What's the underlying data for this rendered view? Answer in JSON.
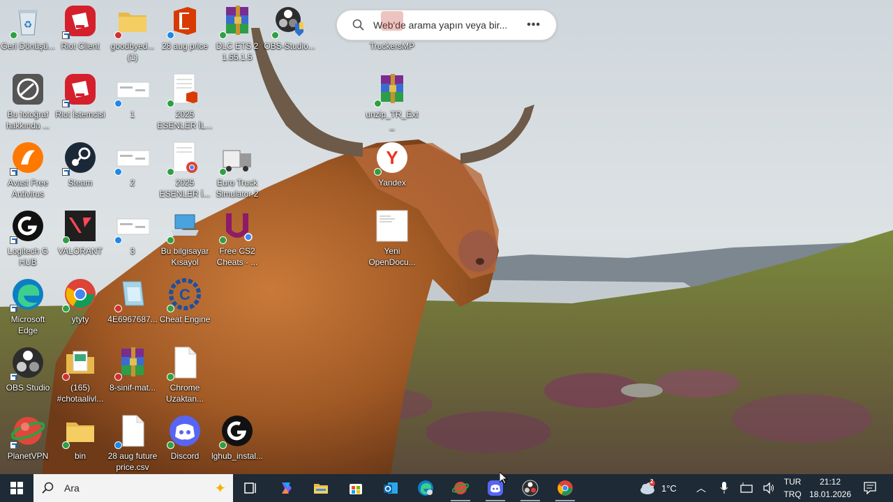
{
  "search_widget": {
    "placeholder": "Web'de arama yapın veya bir...",
    "more_icon": "ellipsis-icon"
  },
  "desktop_icons": [
    {
      "label": "Geri Dönüşü...",
      "icon": "recycle-bin-icon"
    },
    {
      "label": "Riot Client",
      "icon": "riot-icon"
    },
    {
      "label": "goodbyed... (1)",
      "icon": "folder-icon"
    },
    {
      "label": "28 aug price",
      "icon": "office-icon"
    },
    {
      "label": "DLC ETS 2 1.55.1.5",
      "icon": "winrar-icon"
    },
    {
      "label": "OBS-Studio...",
      "icon": "obs-installer-icon"
    },
    {
      "label": "TruckersMP",
      "icon": "truckersmp-icon"
    },
    {
      "label": "Bu fotoğraf hakkında ...",
      "icon": "photo-info-icon"
    },
    {
      "label": "Riot İstemcisi",
      "icon": "riot-icon"
    },
    {
      "label": "1",
      "icon": "image-file-icon"
    },
    {
      "label": "2025 ESENLER İL...",
      "icon": "office-doc-icon"
    },
    {
      "label": "unzip_TR_Ext_",
      "icon": "winrar-icon"
    },
    {
      "label": "Avast Free Antivirus",
      "icon": "avast-icon"
    },
    {
      "label": "Steam",
      "icon": "steam-icon"
    },
    {
      "label": "2",
      "icon": "image-file-icon"
    },
    {
      "label": "2025 ESENLER İ...",
      "icon": "chrome-doc-icon"
    },
    {
      "label": "Euro Truck Simulator 2",
      "icon": "truck-icon"
    },
    {
      "label": "Yandex",
      "icon": "yandex-icon"
    },
    {
      "label": "Logitech G HUB",
      "icon": "logitech-icon"
    },
    {
      "label": "VALORANT",
      "icon": "valorant-icon"
    },
    {
      "label": "3",
      "icon": "image-file-icon"
    },
    {
      "label": "Bu bilgisayar Kısayol",
      "icon": "laptop-icon"
    },
    {
      "label": "Free CS2 Cheats - ...",
      "icon": "u-logo-icon"
    },
    {
      "label": "Yeni OpenDocu...",
      "icon": "document-icon"
    },
    {
      "label": "Microsoft Edge",
      "icon": "edge-icon"
    },
    {
      "label": "ytyty",
      "icon": "chrome-icon"
    },
    {
      "label": "4E6967687...",
      "icon": "file-icon"
    },
    {
      "label": "Cheat Engine",
      "icon": "cheat-engine-icon"
    },
    {
      "label": "OBS Studio",
      "icon": "obs-icon"
    },
    {
      "label": "(165) #chotaalivl...",
      "icon": "folder-doc-icon"
    },
    {
      "label": "8-sinif-mat...",
      "icon": "winrar-icon"
    },
    {
      "label": "Chrome Uzaktan...",
      "icon": "blank-file-icon"
    },
    {
      "label": "PlanetVPN",
      "icon": "planetvpn-icon"
    },
    {
      "label": "bin",
      "icon": "folder-icon"
    },
    {
      "label": "28 aug future price.csv",
      "icon": "blank-file-icon"
    },
    {
      "label": "Discord",
      "icon": "discord-icon"
    },
    {
      "label": "lghub_instal...",
      "icon": "logitech-icon"
    }
  ],
  "taskbar": {
    "search_placeholder": "Ara",
    "weather_temp": "1°C",
    "weather_badge": "2",
    "language_top": "TUR",
    "language_bottom": "TRQ",
    "time": "21:12",
    "date": "18.01.2026",
    "pinned": [
      "task-view-icon",
      "copilot-icon",
      "file-explorer-icon",
      "microsoft-store-icon",
      "outlook-icon",
      "edge-icon",
      "planetvpn-icon",
      "discord-icon",
      "obs-icon",
      "chrome-icon"
    ]
  },
  "colors": {
    "taskbar": "#1e2a35",
    "accent": "#0078d4"
  }
}
